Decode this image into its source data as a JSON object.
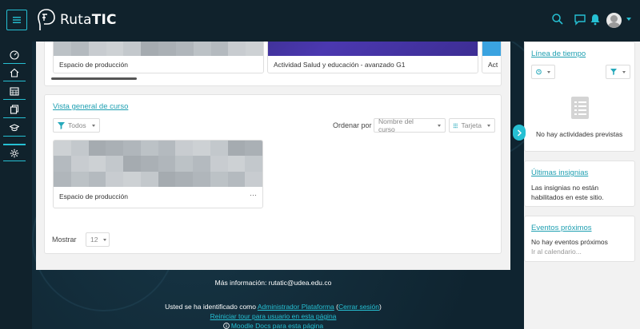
{
  "header": {
    "logo_text_a": "Ruta",
    "logo_text_b": "TIC"
  },
  "sidebar": {
    "items": [
      {
        "name": "dashboard-icon"
      },
      {
        "name": "home-icon"
      },
      {
        "name": "calendar-icon"
      },
      {
        "name": "files-icon"
      },
      {
        "name": "courses-icon"
      },
      {
        "name": "admin-icon"
      }
    ]
  },
  "top_courses": [
    {
      "name": "Espacio de producción"
    },
    {
      "name": "Actividad Salud y educación - avanzado G1"
    },
    {
      "name": "Act"
    }
  ],
  "overview": {
    "title": "Vista general de curso",
    "filter_label": "Todos",
    "sort_label": "Ordenar por",
    "sort_value": "Nombre del curso",
    "view_label": "Tarjeta",
    "course_name": "Espacio de producción",
    "more_label": "···",
    "show_label": "Mostrar",
    "show_value": "12"
  },
  "footer": {
    "more_info": "Más información: rutatic@udea.edu.co",
    "logged_prefix": "Usted se ha identificado como ",
    "user_link": "Administrador Plataforma",
    "open_paren": " (",
    "logout_link": "Cerrar sesión",
    "close_paren": ")",
    "tour_link": "Reiniciar tour para usuario en esta página",
    "docs_link": "Moodle Docs para esta página"
  },
  "blocks": {
    "timeline": {
      "title": "Línea de tiempo",
      "empty": "No hay actividades previstas"
    },
    "badges": {
      "title": "Últimas insignias",
      "text": "Las insignias no están habilitados en este sitio."
    },
    "events": {
      "title": "Eventos próximos",
      "empty": "No hay eventos próximos",
      "calendar_link": "Ir al calendario..."
    }
  },
  "colors": {
    "accent": "#26c0d3",
    "topbar": "#10222c",
    "link": "#1e9fb1"
  }
}
